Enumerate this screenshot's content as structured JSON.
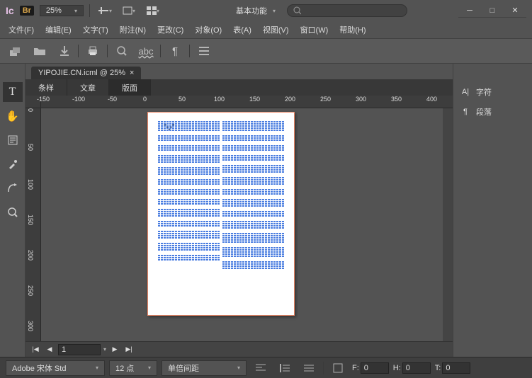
{
  "titlebar": {
    "app": "Ic",
    "bridge": "Br",
    "zoom": "25%",
    "workspace": "基本功能",
    "search_placeholder": ""
  },
  "menu": [
    "文件(F)",
    "编辑(E)",
    "文字(T)",
    "附注(N)",
    "更改(C)",
    "对象(O)",
    "表(A)",
    "视图(V)",
    "窗口(W)",
    "帮助(H)"
  ],
  "doc_tab": "YIPOJIE.CN.icml @ 25%",
  "sub_tabs": [
    "条样",
    "文章",
    "版面"
  ],
  "active_sub_tab": 2,
  "ruler_h": [
    "-150",
    "-100",
    "-50",
    "0",
    "50",
    "100",
    "150",
    "200",
    "250",
    "300",
    "350",
    "400"
  ],
  "ruler_v": [
    "0",
    "50",
    "100",
    "150",
    "200",
    "250",
    "300"
  ],
  "page_nav": {
    "page": "1"
  },
  "side_panels": [
    {
      "icon": "A|",
      "label": "字符"
    },
    {
      "icon": "¶",
      "label": "段落"
    }
  ],
  "bottom": {
    "font": "Adobe 宋体 Std",
    "size": "12 点",
    "leading": "单倍间距",
    "F": "0",
    "H": "0",
    "T": "0",
    "F_label": "F:",
    "H_label": "H:",
    "T_label": "T:"
  }
}
